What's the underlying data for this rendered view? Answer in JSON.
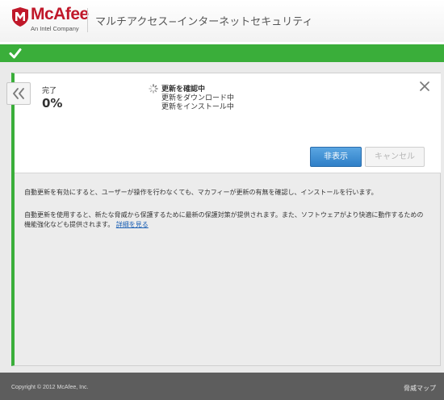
{
  "header": {
    "brand": "McAfee",
    "brand_sub": "An Intel Company",
    "app_title": "マルチアクセス−インターネットセキュリティ"
  },
  "status": {
    "label": "完了",
    "percent": "0%",
    "progress_fraction": 0
  },
  "update": {
    "title": "更新を確認中",
    "line1": "更新をダウンロード中",
    "line2": "更新をインストール中"
  },
  "buttons": {
    "hide": "非表示",
    "cancel": "キャンセル"
  },
  "description": {
    "para1": "自動更新を有効にすると、ユーザーが操作を行わなくても、マカフィーが更新の有無を確認し、インストールを行います。",
    "para2": "自動更新を使用すると、新たな脅威から保護するために最新の保護対策が提供されます。また、ソフトウェアがより快適に動作するための機能強化なども提供されます。",
    "details_link": "詳細を見る"
  },
  "footer": {
    "copyright": "Copyright © 2012 McAfee, Inc.",
    "threat_map": "脅威マップ"
  },
  "colors": {
    "accent_green": "#3aae3a",
    "brand_red": "#c0182a",
    "primary_button": "#2f7fc7",
    "link": "#1a5fb4"
  },
  "icons": {
    "logo": "mcafee-shield-icon",
    "status": "checkmark-icon",
    "back": "double-chevron-left-icon",
    "spinner": "spinner-icon",
    "close": "close-icon"
  }
}
